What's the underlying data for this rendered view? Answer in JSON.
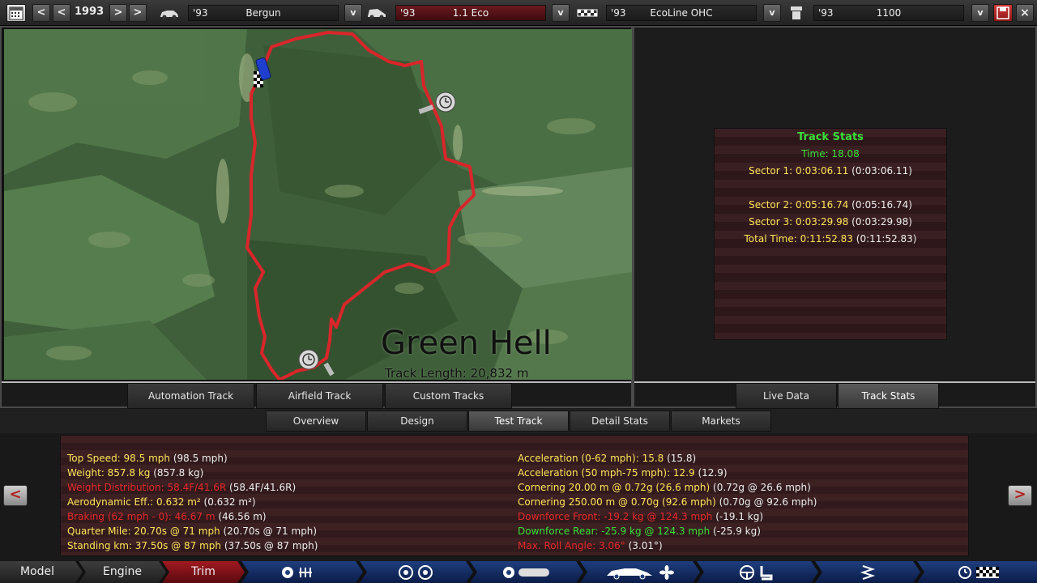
{
  "topbar": {
    "year": "1993",
    "prev_label": "<",
    "next_label": ">",
    "model": {
      "year": "'93",
      "name": "Bergun"
    },
    "trim": {
      "year": "'93",
      "name": "1.1 Eco"
    },
    "engine": {
      "year": "'93",
      "name": "EcoLine OHC"
    },
    "variant": {
      "year": "'93",
      "name": "1100"
    },
    "dropdown_glyph": "v"
  },
  "map": {
    "track_name": "Green Hell",
    "track_length": "Track Length: 20,832 m"
  },
  "map_tabs": [
    "Automation Track",
    "Airfield Track",
    "Custom Tracks"
  ],
  "track_stats": {
    "title": "Track Stats",
    "time": "Time: 18.08",
    "sector1": "Sector 1: 0:03:06.11",
    "sector1_paren": "(0:03:06.11)",
    "sector2": "Sector 2: 0:05:16.74",
    "sector2_paren": "(0:05:16.74)",
    "sector3": "Sector 3: 0:03:29.98",
    "sector3_paren": "(0:03:29.98)",
    "total": "Total Time: 0:11:52.83",
    "total_paren": "(0:11:52.83)"
  },
  "right_tabs": [
    "Live Data",
    "Track Stats"
  ],
  "main_tabs": [
    "Overview",
    "Design",
    "Test Track",
    "Detail Stats",
    "Markets"
  ],
  "stats_left": [
    {
      "label": "Top Speed: 98.5 mph",
      "paren": "(98.5 mph)",
      "color": "#ffe55a"
    },
    {
      "label": "Weight: 857.8 kg",
      "paren": "(857.8 kg)",
      "color": "#ffe55a"
    },
    {
      "label": "Weight Distribution: 58.4F/41.6R",
      "paren": "(58.4F/41.6R)",
      "color": "#e8282a"
    },
    {
      "label": "Aerodynamic Eff.: 0.632 m²",
      "paren": "(0.632 m²)",
      "color": "#ffe55a"
    },
    {
      "label": "Braking (62 mph - 0): 46.67 m",
      "paren": "(46.56 m)",
      "color": "#e8282a"
    },
    {
      "label": "Quarter Mile: 20.70s @ 71 mph",
      "paren": "(20.70s @ 71 mph)",
      "color": "#ffe55a"
    },
    {
      "label": "Standing km: 37.50s @ 87 mph",
      "paren": "(37.50s @ 87 mph)",
      "color": "#ffe55a"
    }
  ],
  "stats_right": [
    {
      "label": "Acceleration (0-62 mph): 15.8",
      "paren": "(15.8)",
      "color": "#ffe55a"
    },
    {
      "label": "Acceleration (50 mph-75 mph): 12.9",
      "paren": "(12.9)",
      "color": "#ffe55a"
    },
    {
      "label": "Cornering 20.00 m @ 0.72g (26.6 mph)",
      "paren": "(0.72g @ 26.6 mph)",
      "color": "#ffe55a"
    },
    {
      "label": "Cornering 250.00 m @ 0.70g (92.6 mph)",
      "paren": "(0.70g @ 92.6 mph)",
      "color": "#ffe55a"
    },
    {
      "label": "Downforce Front: -19.2 kg @ 124.3 mph",
      "paren": "(-19.1 kg)",
      "color": "#e8282a"
    },
    {
      "label": "Downforce Rear: -25.9 kg @ 124.3 mph",
      "paren": "(-25.9 kg)",
      "color": "#3ae03a"
    },
    {
      "label": "Max. Roll Angle: 3.06°",
      "paren": "(3.01°)",
      "color": "#e8282a"
    }
  ],
  "side_arrows": {
    "left": "<",
    "right": ">"
  },
  "bottom_nav": [
    "Model",
    "Engine",
    "Trim"
  ],
  "colors": {
    "accent_red": "#a01a20",
    "nav_blue": "#1f3e7e",
    "track_red": "#d8262a"
  }
}
